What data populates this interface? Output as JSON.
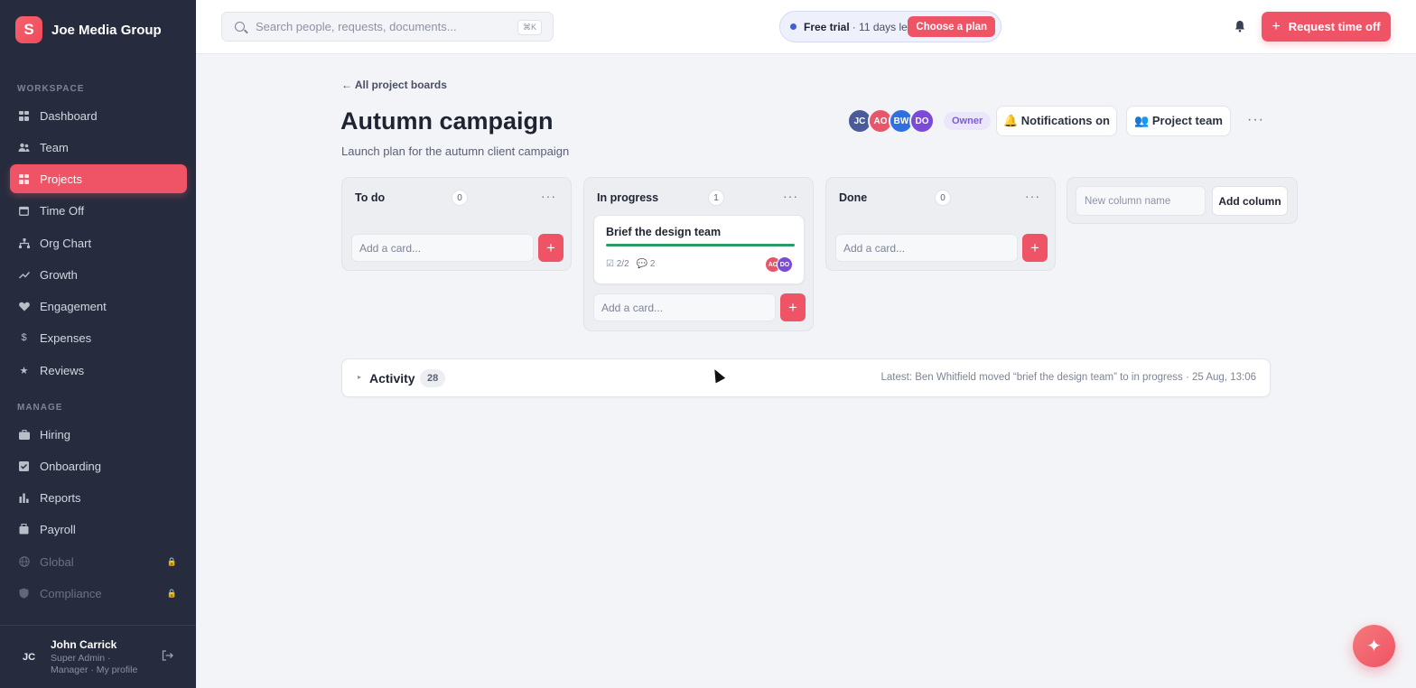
{
  "app": {
    "name": "Joe Media Group",
    "logo_letter": "S",
    "accent": "#ef5366"
  },
  "sidebar": {
    "workspace_label": "WORKSPACE",
    "manage_label": "MANAGE",
    "workspace_items": [
      {
        "label": "Dashboard",
        "icon": "grid-icon"
      },
      {
        "label": "Team",
        "icon": "people-icon"
      },
      {
        "label": "Projects",
        "icon": "grid-icon",
        "active": true
      },
      {
        "label": "Time Off",
        "icon": "calendar-icon"
      },
      {
        "label": "Org Chart",
        "icon": "org-chart-icon"
      },
      {
        "label": "Growth",
        "icon": "trend-icon"
      },
      {
        "label": "Engagement",
        "icon": "heart-icon"
      },
      {
        "label": "Expenses",
        "icon": "dollar-icon"
      },
      {
        "label": "Reviews",
        "icon": "star-icon"
      }
    ],
    "manage_items": [
      {
        "label": "Hiring",
        "icon": "briefcase-icon"
      },
      {
        "label": "Onboarding",
        "icon": "checkbox-icon"
      },
      {
        "label": "Reports",
        "icon": "bar-chart-icon"
      },
      {
        "label": "Payroll",
        "icon": "payroll-icon"
      },
      {
        "label": "Global",
        "icon": "globe-icon",
        "locked": true
      },
      {
        "label": "Compliance",
        "icon": "shield-icon",
        "locked": true
      }
    ],
    "user": {
      "initials": "JC",
      "name": "John Carrick",
      "role": "Super Admin · Manager · My profile"
    }
  },
  "topbar": {
    "search_placeholder": "Search people, requests, documents...",
    "search_shortcut": "⌘K",
    "trial_strong": "Free trial",
    "trial_rest": "· 11 days left",
    "choose_plan": "Choose a plan",
    "request_button": "Request time off"
  },
  "page": {
    "back_link": "← All project boards",
    "title": "Autumn campaign",
    "subtitle": "Launch plan for the autumn client campaign",
    "members": [
      {
        "initials": "JC",
        "color": "#4a5a9a"
      },
      {
        "initials": "AO",
        "color": "#e8566c"
      },
      {
        "initials": "BW",
        "color": "#2f6fe0"
      },
      {
        "initials": "DO",
        "color": "#7b4ad6"
      }
    ],
    "owner_badge": "Owner",
    "notifications_button": "🔔 Notifications on",
    "team_button": "👥 Project team",
    "more": "···"
  },
  "board": {
    "add_card_placeholder": "Add a card...",
    "columns": [
      {
        "title": "To do",
        "count": "0",
        "more": "···"
      },
      {
        "title": "In progress",
        "count": "1",
        "more": "···",
        "card": {
          "title": "Brief the design team",
          "progress": 1.0,
          "checklist": "☑ 2/2",
          "comments": "💬 2",
          "assignees": [
            {
              "initials": "AO",
              "color": "#e8566c"
            },
            {
              "initials": "DO",
              "color": "#7b4ad6"
            }
          ]
        }
      },
      {
        "title": "Done",
        "count": "0",
        "more": "···"
      }
    ],
    "new_column_placeholder": "New column name",
    "add_column_button": "Add column"
  },
  "activity": {
    "chevron": "▸",
    "title": "Activity",
    "count": "28",
    "latest": "Latest: Ben Whitfield moved “brief the design team” to in progress · 25 Aug, 13:06"
  },
  "fab": {
    "icon": "sparkle-icon",
    "glyph": "✦"
  }
}
